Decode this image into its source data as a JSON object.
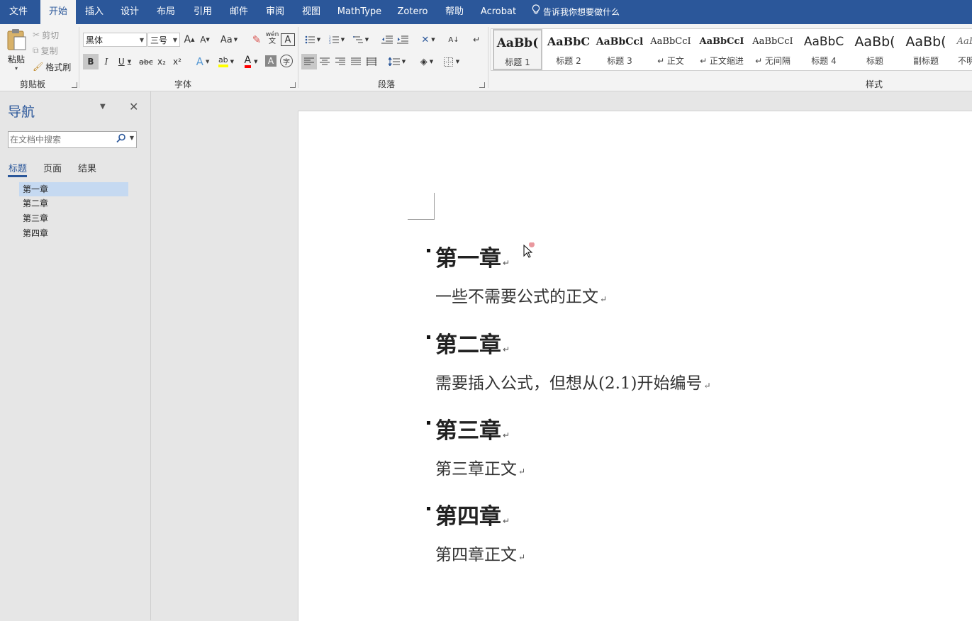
{
  "tabs": [
    "文件",
    "开始",
    "插入",
    "设计",
    "布局",
    "引用",
    "邮件",
    "审阅",
    "视图",
    "MathType",
    "Zotero",
    "帮助",
    "Acrobat"
  ],
  "tell_me": "告诉我你想要做什么",
  "clipboard": {
    "paste": "粘贴",
    "cut": "剪切",
    "copy": "复制",
    "format_painter": "格式刷",
    "label": "剪贴板"
  },
  "font": {
    "name": "黑体",
    "size": "三号",
    "label": "字体",
    "grow": "A",
    "shrink": "A",
    "case": "Aa",
    "phonetic": "wén",
    "bold": "B",
    "italic": "I",
    "underline": "U",
    "strike": "abc",
    "sub": "x₂",
    "sup": "x²",
    "font_color": "A"
  },
  "paragraph": {
    "label": "段落"
  },
  "styles": {
    "label": "样式",
    "items": [
      {
        "preview": "AaBb(",
        "name": "标题 1"
      },
      {
        "preview": "AaBbC",
        "name": "标题 2"
      },
      {
        "preview": "AaBbCcl",
        "name": "标题 3"
      },
      {
        "preview": "AaBbCcI",
        "name": "↵ 正文"
      },
      {
        "preview": "AaBbCcI",
        "name": "↵ 正文缩进"
      },
      {
        "preview": "AaBbCcI",
        "name": "↵ 无间隔"
      },
      {
        "preview": "AaBbC",
        "name": "标题 4"
      },
      {
        "preview": "AaBb(",
        "name": "标题"
      },
      {
        "preview": "AaBb(",
        "name": "副标题"
      },
      {
        "preview": "AaB",
        "name": "不明"
      }
    ]
  },
  "nav": {
    "title": "导航",
    "search_placeholder": "在文档中搜索",
    "tabs": [
      "标题",
      "页面",
      "结果"
    ],
    "headings": [
      "第一章",
      "第二章",
      "第三章",
      "第四章"
    ]
  },
  "document": {
    "blocks": [
      {
        "heading": "第一章",
        "body": "一些不需要公式的正文"
      },
      {
        "heading": "第二章",
        "body": "需要插入公式，但想从(2.1)开始编号"
      },
      {
        "heading": "第三章",
        "body": "第三章正文"
      },
      {
        "heading": "第四章",
        "body": "第四章正文"
      }
    ],
    "para_mark": "↵"
  },
  "colors": {
    "accent": "#2b579a",
    "highlight": "#ffff00",
    "font_color": "#ff0000",
    "nav_selected": "#c5d9f1"
  }
}
